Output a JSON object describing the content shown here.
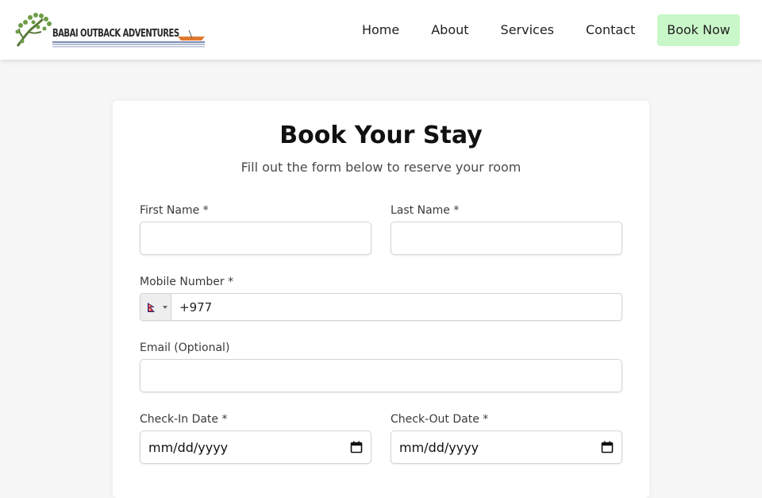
{
  "header": {
    "logo_text": "BABAI OUTBACK ADVENTURES",
    "logo_tagline": "BARDIYA NATIONAL PARK",
    "nav": [
      "Home",
      "About",
      "Services",
      "Contact"
    ],
    "cta": "Book Now",
    "cta_color": "#c9f7c9"
  },
  "form": {
    "title": "Book Your Stay",
    "subtitle": "Fill out the form below to reserve your room",
    "first_name": {
      "label": "First Name *",
      "value": ""
    },
    "last_name": {
      "label": "Last Name *",
      "value": ""
    },
    "mobile": {
      "label": "Mobile Number *",
      "country": "Nepal",
      "country_icon": "nepal-flag-icon",
      "value": "+977"
    },
    "email": {
      "label": "Email (Optional)",
      "value": ""
    },
    "check_in": {
      "label": "Check-In Date *",
      "placeholder": "mm/dd/yyyy",
      "icon": "calendar-icon"
    },
    "check_out": {
      "label": "Check-Out Date *",
      "placeholder": "mm/dd/yyyy",
      "icon": "calendar-icon"
    }
  }
}
